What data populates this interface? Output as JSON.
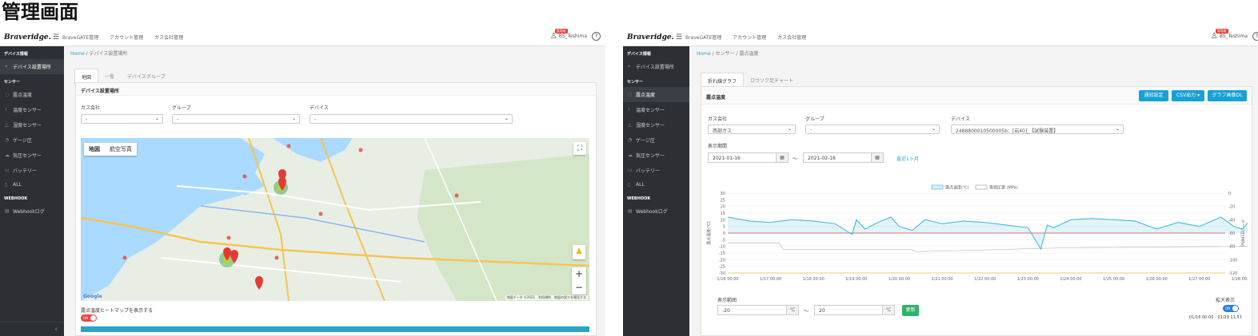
{
  "page_title": "管理画面",
  "common": {
    "logo": "Braveridge.",
    "nav": [
      "BraveGATE管理",
      "アカウント管理",
      "ガス会社管理"
    ],
    "user_name": "BS_Teshima",
    "user_badge": "管理者",
    "help_glyph": "?",
    "sidebar": {
      "section_device": "デバイス情報",
      "device_location": "デバイス設置場所",
      "section_sensor": "センサー",
      "sensor_items": [
        "露点温度",
        "温度センサー",
        "湿度センサー",
        "ゲージ圧",
        "気圧センサー",
        "バッテリー",
        "ALL"
      ],
      "section_webhook": "WEBHOOK",
      "webhook_log": "Webhookログ"
    }
  },
  "left": {
    "breadcrumb": {
      "home": "Home",
      "sep": "/",
      "current": "デバイス設置場所"
    },
    "tabs": [
      "地図",
      "一覧",
      "デバイスグループ"
    ],
    "card_title": "デバイス設置場所",
    "filters": [
      {
        "label": "ガス会社",
        "value": "-"
      },
      {
        "label": "グループ",
        "value": "-"
      },
      {
        "label": "デバイス",
        "value": "-"
      }
    ],
    "map": {
      "types": [
        "地図",
        "航空写真"
      ],
      "fullscreen": "⛶",
      "zoom_in": "+",
      "zoom_out": "−",
      "google": "Google",
      "credit": "地図データ ©2021　利用規約　地図の誤りを報告する"
    },
    "heatmap_label": "露点温度ヒートマップを表示する",
    "heatmap_toggle": "ON"
  },
  "right": {
    "breadcrumb": {
      "home": "Home",
      "sep": "/",
      "mid": "センサー",
      "sep2": "/",
      "current": "露点温度"
    },
    "tabs": [
      "折れ線グラフ",
      "ロウソク足チャート"
    ],
    "card_title": "露点温度",
    "buttons": [
      "通知設定",
      "CSV出力 ▾",
      "グラフ画像DL"
    ],
    "filters": [
      {
        "label": "ガス会社",
        "value": "西部ガス"
      },
      {
        "label": "グループ",
        "value": "-"
      },
      {
        "label": "デバイス",
        "value": "2488800010500005b：[岩40]_【試験装置】"
      }
    ],
    "period_label": "表示期間",
    "date_from": "2021-01-16",
    "date_to": "2021-02-16",
    "tilde": "〜",
    "previous_month": "直近1ヶ月",
    "calendar_icon": "▦",
    "range_label": "表示範囲",
    "range_min": "-20",
    "range_max": "20",
    "unit": "℃",
    "update_button": "更新",
    "expand_label": "拡大表示",
    "expand_toggle": "ON",
    "period_note": "01/16 00:00 - 01/29 11:53",
    "chart_data": {
      "type": "line",
      "legend": [
        "露点温度(℃)",
        "等価圧置 (MPa)"
      ],
      "ylabel_left": "露点温度(℃)",
      "ylabel_right": "ゲージ圧(MPa)",
      "y_left_ticks": [
        30,
        25,
        20,
        15,
        10,
        5,
        0,
        -5,
        -10,
        -15,
        -20,
        -25,
        -30
      ],
      "y_right_ticks": [
        0,
        -20,
        -40,
        -60,
        -80,
        -100,
        -120
      ],
      "x_ticks": [
        "1/16 00:00",
        "1/17 00:00",
        "1/18 00:00",
        "1/19 00:00",
        "1/20 00:00",
        "1/21 00:00",
        "1/22 00:00",
        "1/23 00:00",
        "1/24 00:00",
        "1/25 00:00",
        "1/26 00:00",
        "1/27 00:00",
        "1/28 00:00"
      ],
      "ylim": [
        -30,
        30
      ],
      "colors": {
        "dew": "#3ab5d8",
        "pressure": "#bbbbbb",
        "zero": "#e04040",
        "base": "#e8c040"
      },
      "series": [
        {
          "name": "露点温度(℃)",
          "x": [
            0,
            0.5,
            1,
            1.5,
            2,
            2.5,
            2.9,
            3.0,
            3.2,
            3.5,
            3.8,
            4.0,
            4.3,
            4.6,
            5.0,
            5.5,
            6.0,
            6.5,
            7.0,
            7.3,
            7.45,
            7.6,
            8.0,
            8.5,
            9.0,
            9.5,
            10.0,
            10.5,
            11.0,
            11.5,
            11.8,
            12.0,
            12.3,
            12.6
          ],
          "y": [
            12,
            9,
            8,
            10,
            9,
            7,
            -1,
            10,
            3,
            8,
            12,
            5,
            2,
            10,
            7,
            9,
            8,
            6,
            4,
            -12,
            6,
            4,
            10,
            11,
            10,
            9,
            3,
            8,
            5,
            12,
            5,
            3,
            14,
            12
          ]
        },
        {
          "name": "等価圧置 (MPa)",
          "x": [
            0,
            1.2,
            1.3,
            4.3,
            4.4,
            8.0,
            12.0,
            12.6
          ],
          "y": [
            -75,
            -75,
            -85,
            -85,
            -88,
            -82,
            -80,
            -82
          ]
        }
      ]
    }
  }
}
